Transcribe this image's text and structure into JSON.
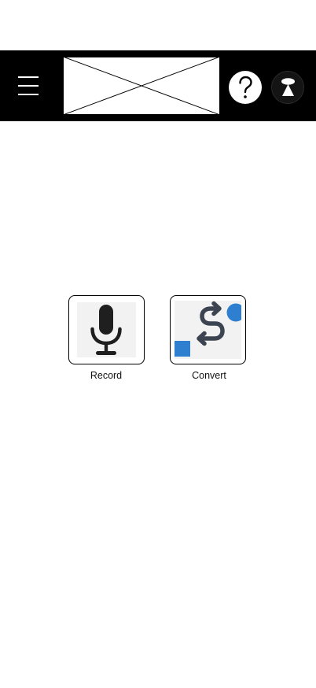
{
  "header": {
    "menu_icon": "hamburger-menu-icon",
    "logo_placeholder": "image-placeholder",
    "help_icon": "question-mark-icon",
    "profile_icon": "user-avatar-icon",
    "background": "#000000"
  },
  "actions": [
    {
      "label": "Record",
      "icon": "microphone-icon"
    },
    {
      "label": "Convert",
      "icon": "convert-arrows-icon",
      "accent": "#2f7fd1"
    }
  ]
}
